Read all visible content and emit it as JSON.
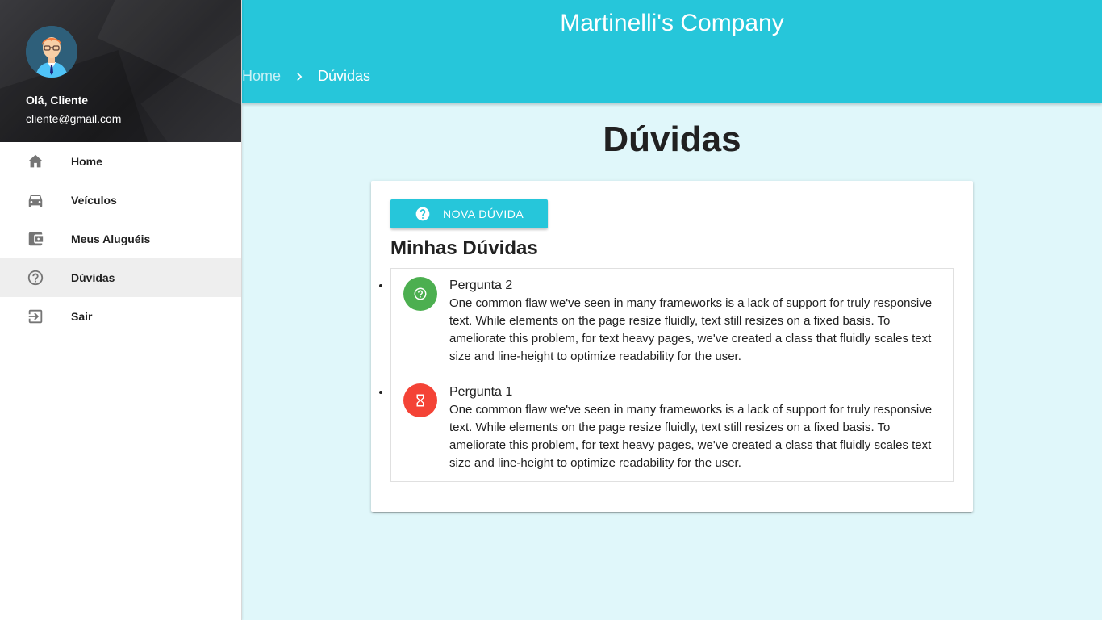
{
  "sidebar": {
    "user": {
      "greeting": "Olá, Cliente",
      "email": "cliente@gmail.com",
      "avatar_icon": "user-avatar-icon"
    },
    "items": [
      {
        "label": "Home",
        "icon": "home-icon"
      },
      {
        "label": "Veículos",
        "icon": "car-icon"
      },
      {
        "label": "Meus Aluguéis",
        "icon": "wallet-icon"
      },
      {
        "label": "Dúvidas",
        "icon": "help-circle-icon",
        "active": true
      },
      {
        "label": "Sair",
        "icon": "exit-icon"
      }
    ]
  },
  "header": {
    "brand": "Martinelli's Company",
    "breadcrumbs": {
      "home": "Home",
      "current": "Dúvidas"
    }
  },
  "main": {
    "title": "Dúvidas",
    "new_button": "NOVA DÚVIDA",
    "section_title": "Minhas Dúvidas",
    "questions": [
      {
        "title": "Pergunta 2",
        "text": "One common flaw we've seen in many frameworks is a lack of support for truly responsive text. While elements on the page resize fluidly, text still resizes on a fixed basis. To ameliorate this problem, for text heavy pages, we've created a class that fluidly scales text size and line-height to optimize readability for the user.",
        "status_icon": "help-icon",
        "status_color": "#4caf50"
      },
      {
        "title": "Pergunta 1",
        "text": "One common flaw we've seen in many frameworks is a lack of support for truly responsive text. While elements on the page resize fluidly, text still resizes on a fixed basis. To ameliorate this problem, for text heavy pages, we've created a class that fluidly scales text size and line-height to optimize readability for the user.",
        "status_icon": "hourglass-icon",
        "status_color": "#f44336"
      }
    ]
  },
  "colors": {
    "accent": "#26c6da",
    "background": "#e0f7fa"
  }
}
